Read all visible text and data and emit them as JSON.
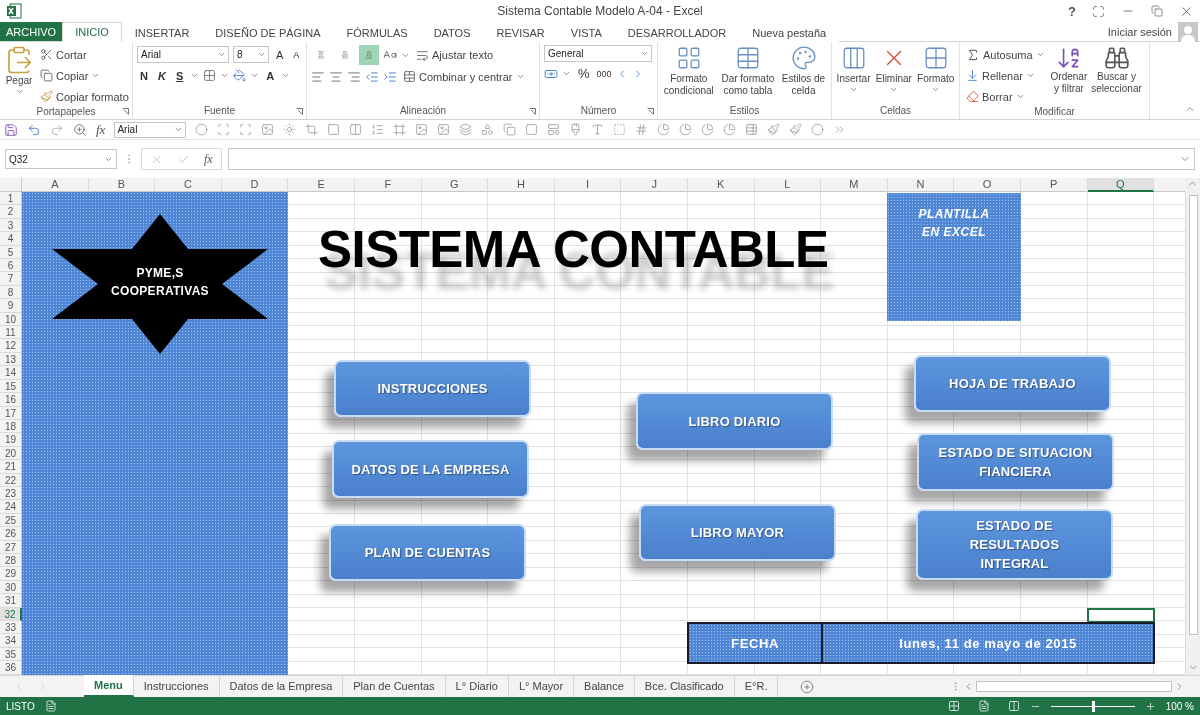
{
  "window": {
    "title": "Sistema Contable Modelo A-04 - Excel",
    "help": "?"
  },
  "file_tab": "ARCHIVO",
  "ribbon_tabs": [
    {
      "label": "INICIO",
      "selected": true
    },
    {
      "label": "INSERTAR",
      "selected": false
    },
    {
      "label": "DISEÑO DE PÁGINA",
      "selected": false
    },
    {
      "label": "FÓRMULAS",
      "selected": false
    },
    {
      "label": "DATOS",
      "selected": false
    },
    {
      "label": "REVISAR",
      "selected": false
    },
    {
      "label": "VISTA",
      "selected": false
    },
    {
      "label": "DESARROLLADOR",
      "selected": false
    },
    {
      "label": "Nueva pestaña",
      "selected": false
    }
  ],
  "sign_in": "Iniciar sesión",
  "ribbon": {
    "clipboard": {
      "label": "Portapapeles",
      "paste": "Pegar",
      "cut": "Cortar",
      "copy": "Copiar",
      "format_painter": "Copiar formato"
    },
    "font": {
      "label": "Fuente",
      "name": "Arial",
      "size": "8",
      "bold": "N",
      "italic": "K",
      "underline": "S",
      "grow": "A",
      "shrink": "A",
      "font_color_glyph": "A"
    },
    "alignment": {
      "label": "Alineación",
      "wrap": "Ajustar texto",
      "merge": "Combinar y centrar",
      "vertical": [
        {
          "selected": false
        },
        {
          "selected": false
        },
        {
          "selected": true
        }
      ]
    },
    "number": {
      "label": "Número",
      "format": "General",
      "percent": "%",
      "thousands": "000"
    },
    "styles": {
      "label": "Estilos",
      "commands": [
        {
          "lines": [
            "Formato",
            "condicional"
          ]
        },
        {
          "lines": [
            "Dar formato",
            "como tabla"
          ]
        },
        {
          "lines": [
            "Estilos de",
            "celda"
          ]
        }
      ]
    },
    "cells": {
      "label": "Celdas",
      "commands": [
        {
          "label": "Insertar"
        },
        {
          "label": "Eliminar"
        },
        {
          "label": "Formato"
        }
      ]
    },
    "editing": {
      "label": "Modificar",
      "autosum": "Autosuma",
      "fill": "Rellenar",
      "clear": "Borrar",
      "sort": [
        "Ordenar",
        "y filtrar"
      ],
      "find": [
        "Buscar y",
        "seleccionar"
      ]
    }
  },
  "quick_access": {
    "function": "fx",
    "font": "Arial"
  },
  "formula_bar": {
    "name_box": "Q32",
    "function": "fx"
  },
  "columns": [
    {
      "label": "A",
      "selected": false
    },
    {
      "label": "B",
      "selected": false
    },
    {
      "label": "C",
      "selected": false
    },
    {
      "label": "D",
      "selected": false
    },
    {
      "label": "E",
      "selected": false
    },
    {
      "label": "F",
      "selected": false
    },
    {
      "label": "G",
      "selected": false
    },
    {
      "label": "H",
      "selected": false
    },
    {
      "label": "I",
      "selected": false
    },
    {
      "label": "J",
      "selected": false
    },
    {
      "label": "K",
      "selected": false
    },
    {
      "label": "L",
      "selected": false
    },
    {
      "label": "M",
      "selected": false
    },
    {
      "label": "N",
      "selected": false
    },
    {
      "label": "O",
      "selected": false
    },
    {
      "label": "P",
      "selected": false
    },
    {
      "label": "Q",
      "selected": true
    }
  ],
  "rows": [
    {
      "label": "1",
      "selected": false
    },
    {
      "label": "2",
      "selected": false
    },
    {
      "label": "3",
      "selected": false
    },
    {
      "label": "4",
      "selected": false
    },
    {
      "label": "5",
      "selected": false
    },
    {
      "label": "6",
      "selected": false
    },
    {
      "label": "7",
      "selected": false
    },
    {
      "label": "8",
      "selected": false
    },
    {
      "label": "9",
      "selected": false
    },
    {
      "label": "10",
      "selected": false
    },
    {
      "label": "11",
      "selected": false
    },
    {
      "label": "12",
      "selected": false
    },
    {
      "label": "13",
      "selected": false
    },
    {
      "label": "14",
      "selected": false
    },
    {
      "label": "15",
      "selected": false
    },
    {
      "label": "16",
      "selected": false
    },
    {
      "label": "17",
      "selected": false
    },
    {
      "label": "18",
      "selected": false
    },
    {
      "label": "19",
      "selected": false
    },
    {
      "label": "20",
      "selected": false
    },
    {
      "label": "21",
      "selected": false
    },
    {
      "label": "22",
      "selected": false
    },
    {
      "label": "23",
      "selected": false
    },
    {
      "label": "24",
      "selected": false
    },
    {
      "label": "25",
      "selected": false
    },
    {
      "label": "26",
      "selected": false
    },
    {
      "label": "27",
      "selected": false
    },
    {
      "label": "28",
      "selected": false
    },
    {
      "label": "29",
      "selected": false
    },
    {
      "label": "30",
      "selected": false
    },
    {
      "label": "31",
      "selected": false
    },
    {
      "label": "32",
      "selected": true
    },
    {
      "label": "33",
      "selected": false
    },
    {
      "label": "34",
      "selected": false
    },
    {
      "label": "35",
      "selected": false
    },
    {
      "label": "36",
      "selected": false
    }
  ],
  "sheet": {
    "title": "SISTEMA CONTABLE",
    "star": [
      "PYME,S",
      "COOPERATIVAS"
    ],
    "badge": [
      "PLANTILLA",
      "EN EXCEL"
    ],
    "buttons": [
      {
        "lines": [
          "INSTRUCCIONES"
        ]
      },
      {
        "lines": [
          "DATOS DE LA EMPRESA"
        ]
      },
      {
        "lines": [
          "PLAN DE CUENTAS"
        ]
      },
      {
        "lines": [
          "LIBRO DIARIO"
        ]
      },
      {
        "lines": [
          "LIBRO MAYOR"
        ]
      },
      {
        "lines": [
          "HOJA DE TRABAJO"
        ]
      },
      {
        "lines": [
          "ESTADO DE SITUACION",
          "FIANCIERA"
        ]
      },
      {
        "lines": [
          "ESTADO DE",
          "RESULTADOS",
          "INTEGRAL"
        ]
      }
    ],
    "date_label": "FECHA",
    "date_value": "lunes, 11 de mayo de 2015"
  },
  "sheet_tabs": [
    {
      "label": "Menu",
      "selected": true
    },
    {
      "label": "Instrucciones",
      "selected": false
    },
    {
      "label": "Datos de la Empresa",
      "selected": false
    },
    {
      "label": "Plan de Cuentas",
      "selected": false
    },
    {
      "label": "L° Diario",
      "selected": false
    },
    {
      "label": "L° Mayor",
      "selected": false
    },
    {
      "label": "Balance",
      "selected": false
    },
    {
      "label": "Bce. Clasificado",
      "selected": false
    },
    {
      "label": "E°R.",
      "selected": false
    }
  ],
  "status": {
    "mode": "LISTO",
    "zoom": "100 %",
    "zoom_slider": {
      "level": 0.5
    }
  }
}
